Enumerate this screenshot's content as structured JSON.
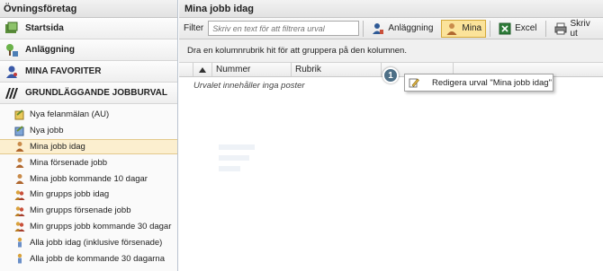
{
  "sidebar": {
    "title": "Övningsföretag",
    "main_items": [
      {
        "label": "Startsida",
        "icon": "home-icon"
      },
      {
        "label": "Anläggning",
        "icon": "facility-icon"
      },
      {
        "label": "MINA FAVORITER",
        "icon": "favorites-icon"
      },
      {
        "label": "GRUNDLÄGGANDE JOBBURVAL",
        "icon": "job-selection-icon"
      }
    ],
    "items": [
      {
        "label": "Nya felanmälan (AU)",
        "icon": "fault-report-icon"
      },
      {
        "label": "Nya jobb",
        "icon": "new-job-icon"
      },
      {
        "label": "Mina jobb idag",
        "icon": "person-icon",
        "selected": true
      },
      {
        "label": "Mina försenade jobb",
        "icon": "person-icon"
      },
      {
        "label": "Mina jobb kommande 10 dagar",
        "icon": "person-icon"
      },
      {
        "label": "Min grupps jobb idag",
        "icon": "group-icon"
      },
      {
        "label": "Min grupps försenade jobb",
        "icon": "group-icon"
      },
      {
        "label": "Min grupps jobb kommande 30 dagar",
        "icon": "group-icon"
      },
      {
        "label": "Alla jobb idag (inklusive försenade)",
        "icon": "all-jobs-icon"
      },
      {
        "label": "Alla jobb de kommande 30 dagarna",
        "icon": "all-jobs-icon"
      }
    ]
  },
  "main": {
    "title": "Mina jobb idag",
    "toolbar": {
      "filter_label": "Filter",
      "filter_placeholder": "Skriv en text för att filtrera urval",
      "anlaggning_label": "Anläggning",
      "mina_label": "Mina",
      "excel_label": "Excel",
      "print_label": "Skriv ut"
    },
    "group_hint": "Dra en kolumnrubrik hit för att gruppera på den kolumnen.",
    "columns": [
      "Nummer",
      "Rubrik"
    ],
    "empty_message": "Urvalet innehåller inga poster"
  },
  "popup": {
    "badge": "1",
    "label": "Redigera urval \"Mina jobb idag\""
  },
  "colors": {
    "selected_bg": "#fcefcf",
    "active_button": "#fbe39a",
    "badge": "#4d6f86"
  }
}
